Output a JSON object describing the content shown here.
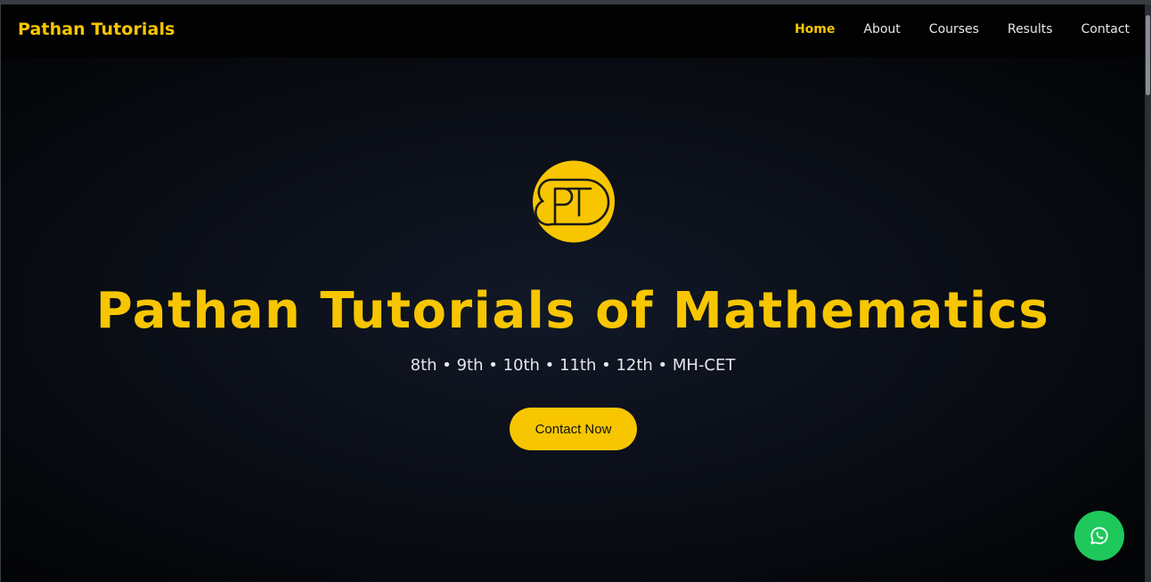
{
  "brand": "Pathan Tutorials",
  "nav": {
    "items": [
      "Home",
      "About",
      "Courses",
      "Results",
      "Contact"
    ],
    "active": "Home"
  },
  "hero": {
    "logo_text": "PT",
    "title": "Pathan Tutorials of Mathematics",
    "subtitle": "8th • 9th • 10th • 11th • 12th • MH-CET",
    "cta_label": "Contact Now"
  },
  "floating": {
    "icon": "whatsapp-icon"
  },
  "colors": {
    "accent": "#f7c600",
    "whatsapp": "#1ec85b",
    "background": "#0b0f18"
  }
}
